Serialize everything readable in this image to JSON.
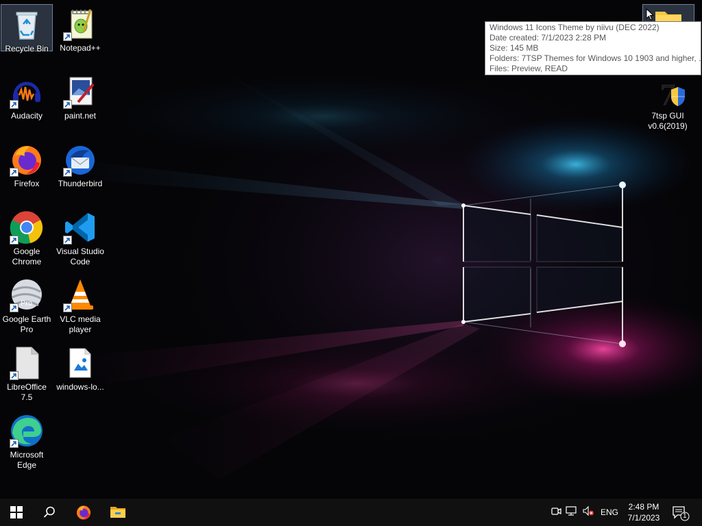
{
  "desktop": {
    "icons": [
      {
        "id": "recycle-bin",
        "label": "Recycle Bin",
        "icon": "recycle-bin-icon",
        "selected": true
      },
      {
        "id": "notepad-plus-plus",
        "label": "Notepad++",
        "icon": "notepad-plus-plus-icon"
      },
      {
        "id": "audacity",
        "label": "Audacity",
        "icon": "audacity-icon"
      },
      {
        "id": "paint-net",
        "label": "paint.net",
        "icon": "paint-net-icon"
      },
      {
        "id": "firefox",
        "label": "Firefox",
        "icon": "firefox-icon"
      },
      {
        "id": "thunderbird",
        "label": "Thunderbird",
        "icon": "thunderbird-icon"
      },
      {
        "id": "google-chrome",
        "label": "Google Chrome",
        "icon": "chrome-icon"
      },
      {
        "id": "vscode",
        "label": "Visual Studio Code",
        "icon": "vscode-icon"
      },
      {
        "id": "google-earth-pro",
        "label": "Google Earth Pro",
        "icon": "google-earth-pro-icon",
        "badge": "Pro"
      },
      {
        "id": "vlc",
        "label": "VLC media player",
        "icon": "vlc-icon"
      },
      {
        "id": "libreoffice",
        "label": "LibreOffice 7.5",
        "icon": "libreoffice-icon"
      },
      {
        "id": "windows-logo-file",
        "label": "windows-lo...",
        "icon": "image-file-icon"
      },
      {
        "id": "microsoft-edge",
        "label": "Microsoft Edge",
        "icon": "edge-icon"
      },
      {
        "id": "7tsp-gui",
        "label": "7tsp GUI v0.6(2019)",
        "icon": "7tsp-icon"
      },
      {
        "id": "themes-folder",
        "label": "",
        "icon": "folder-icon"
      }
    ]
  },
  "tooltip": {
    "lines": [
      "Windows 11 Icons Theme by niivu (DEC 2022)",
      "Date created: 7/1/2023 2:28 PM",
      "Size: 145 MB",
      "Folders: 7TSP Themes for Windows 10 1903 and higher, ...",
      "Files: Preview, READ"
    ]
  },
  "taskbar": {
    "start": "windows-start-icon",
    "search": "search-icon",
    "pinned": [
      "firefox-icon",
      "file-explorer-icon"
    ],
    "tray": {
      "icons": [
        "meet-now-icon",
        "network-icon",
        "volume-muted-icon"
      ],
      "language": "ENG",
      "time": "2:48 PM",
      "date": "7/1/2023",
      "notification_count": "1"
    }
  },
  "colors": {
    "taskbar": "#101010",
    "selection": "#7896b4",
    "tooltip_text": "#575757",
    "wallpaper_cyan": "#1ea0d2",
    "wallpaper_magenta": "#c8147a"
  }
}
